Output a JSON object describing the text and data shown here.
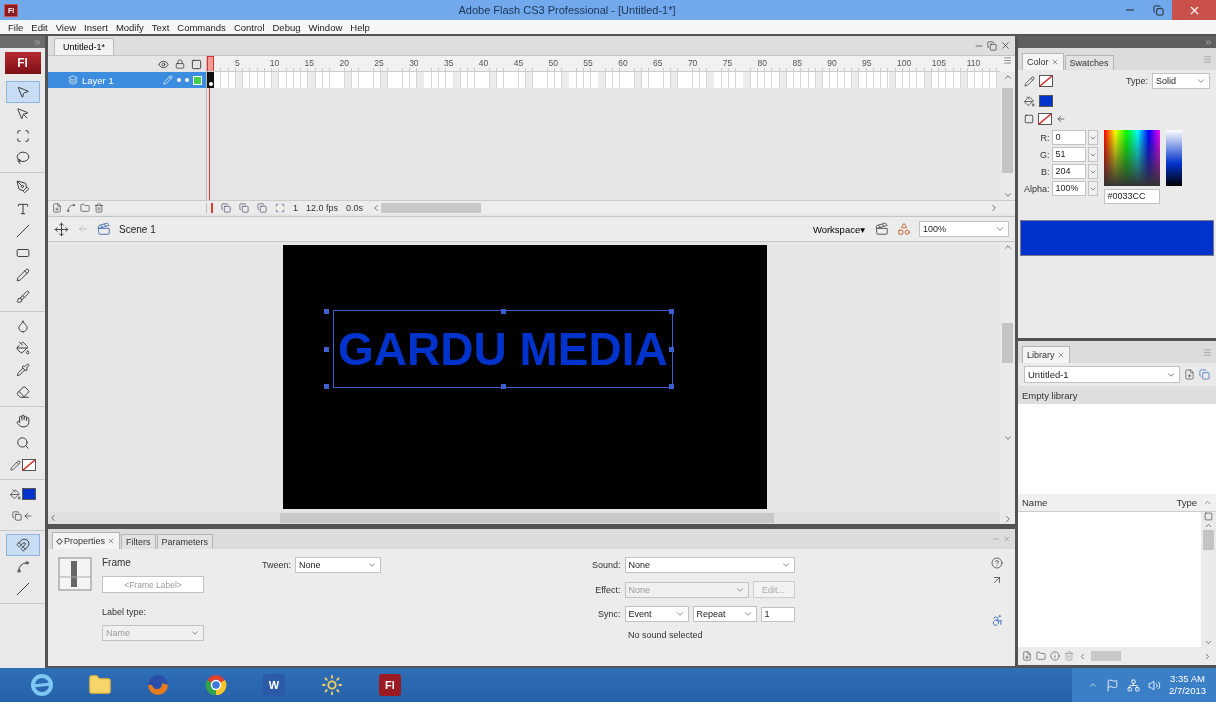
{
  "window": {
    "title": "Adobe Flash CS3 Professional - [Untitled-1*]",
    "badge": "Fl"
  },
  "menu": [
    "File",
    "Edit",
    "View",
    "Insert",
    "Modify",
    "Text",
    "Commands",
    "Control",
    "Debug",
    "Window",
    "Help"
  ],
  "toolbar": {
    "logo": "Fl",
    "groups": [
      [
        {
          "kind": "selection",
          "selected": true
        },
        {
          "kind": "subselection",
          "selected": false
        },
        {
          "kind": "transform",
          "selected": false
        },
        {
          "kind": "lasso",
          "selected": false
        }
      ],
      [
        {
          "kind": "pen",
          "selected": false
        },
        {
          "kind": "text",
          "selected": false
        },
        {
          "kind": "line",
          "selected": false
        },
        {
          "kind": "rectangle",
          "selected": false
        },
        {
          "kind": "pencil",
          "selected": false
        },
        {
          "kind": "brush",
          "selected": false
        }
      ],
      [
        {
          "kind": "inkbottle",
          "selected": false
        },
        {
          "kind": "bucket",
          "selected": false
        },
        {
          "kind": "eyedropper",
          "selected": false
        },
        {
          "kind": "eraser",
          "selected": false
        }
      ],
      [
        {
          "kind": "hand",
          "selected": false
        },
        {
          "kind": "zoom",
          "selected": false
        },
        {
          "kind": "stroke-color",
          "selected": false
        }
      ],
      [
        {
          "kind": "fill-color",
          "selected": false
        },
        {
          "kind": "color-swap",
          "selected": false
        }
      ],
      [
        {
          "kind": "snap",
          "selected": true
        },
        {
          "kind": "smooth",
          "selected": false
        },
        {
          "kind": "straighten",
          "selected": false
        }
      ]
    ]
  },
  "document": {
    "tab": "Untitled-1*"
  },
  "timeline": {
    "ruler": [
      "5",
      "10",
      "15",
      "20",
      "25",
      "30",
      "35",
      "40",
      "45",
      "50",
      "55",
      "60",
      "65",
      "70",
      "75",
      "80",
      "85",
      "90",
      "95",
      "100",
      "105",
      "110"
    ],
    "layers": [
      {
        "name": "Layer 1",
        "selected": true
      }
    ],
    "current_frame": "1",
    "frame_rate": "12.0 fps",
    "elapsed": "0.0s"
  },
  "scene_bar": {
    "scene": "Scene 1",
    "workspace": "Workspace▾",
    "zoom": "100%"
  },
  "stage": {
    "text": "GARDU MEDIA",
    "selected": true
  },
  "properties": {
    "tabs": [
      {
        "label": "Properties",
        "selected": true
      },
      {
        "label": "Filters",
        "selected": false
      },
      {
        "label": "Parameters",
        "selected": false
      }
    ],
    "heading": "Frame",
    "frame_label": {
      "placeholder": "<Frame Label>"
    },
    "label_type": {
      "label": "Label type:",
      "value": "Name",
      "disabled": true
    },
    "tween": {
      "label": "Tween:",
      "value": "None"
    },
    "sound": {
      "label": "Sound:",
      "value": "None"
    },
    "effect": {
      "label": "Effect:",
      "value": "None",
      "disabled": true
    },
    "edit_button": {
      "label": "Edit...",
      "disabled": true
    },
    "sync": {
      "label": "Sync:",
      "value": "Event"
    },
    "repeat": {
      "value": "Repeat"
    },
    "repeat_count": "1",
    "note": "No sound selected"
  },
  "color_panel": {
    "tabs": [
      {
        "label": "Color",
        "selected": true
      },
      {
        "label": "Swatches",
        "selected": false
      }
    ],
    "type": {
      "label": "Type:",
      "value": "Solid"
    },
    "channels": [
      {
        "label": "R:",
        "value": "0"
      },
      {
        "label": "G:",
        "value": "51"
      },
      {
        "label": "B:",
        "value": "204"
      },
      {
        "label": "Alpha:",
        "value": "100%"
      }
    ],
    "hex": "#0033CC"
  },
  "library": {
    "tabs": [
      {
        "label": "Library",
        "selected": true
      }
    ],
    "document": "Untitled-1",
    "status": "Empty library",
    "columns": [
      "Name",
      "Type"
    ]
  },
  "taskbar": {
    "apps": [
      {
        "kind": "ie"
      },
      {
        "kind": "folder"
      },
      {
        "kind": "firefox"
      },
      {
        "kind": "chrome"
      },
      {
        "kind": "word",
        "label": "W"
      },
      {
        "kind": "sun"
      },
      {
        "kind": "flash",
        "label": "Fl"
      }
    ],
    "time": "3:35 AM",
    "date": "2/7/2013"
  }
}
